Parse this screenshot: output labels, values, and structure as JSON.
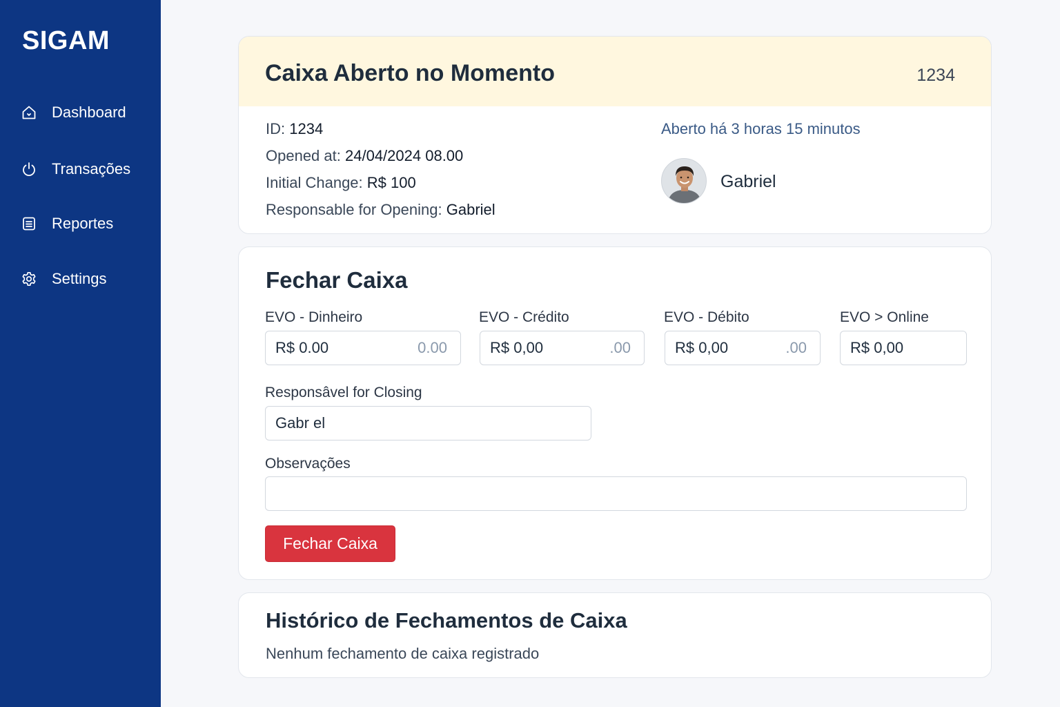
{
  "sidebar": {
    "brand": "SIGAM",
    "items": [
      {
        "label": "Dashboard",
        "icon": "home-icon"
      },
      {
        "label": "Transações",
        "icon": "power-icon"
      },
      {
        "label": "Reportes",
        "icon": "document-icon"
      },
      {
        "label": "Settings",
        "icon": "gear-icon"
      }
    ]
  },
  "open_card": {
    "title": "Caixa Aberto no Momento",
    "header_id": "1234",
    "id_label": "ID:",
    "id_value": "1234",
    "opened_label": "Opened at:",
    "opened_value": "24/04/2024 08.00",
    "change_label": "Initial Change:",
    "change_value": "R$ 100",
    "resp_label": "Responsable for Opening:",
    "resp_value": "Gabriel",
    "elapsed": "Aberto há 3 horas 15 minutos",
    "user_name": "Gabriel"
  },
  "close_card": {
    "title": "Fechar Caixa",
    "fields": [
      {
        "label": "EVO - Dinheiro",
        "value": "R$ 0.00",
        "placeholder": "0.00"
      },
      {
        "label": "EVO - Crédito",
        "value": "R$ 0,00",
        "placeholder": ".00"
      },
      {
        "label": "EVO - Débito",
        "value": "R$ 0,00",
        "placeholder": ".00"
      },
      {
        "label": "EVO > Online",
        "value": "R$ 0,00",
        "placeholder": ""
      }
    ],
    "resp_label": "Responsâvel for Closing",
    "resp_value": "Gabr el",
    "obs_label": "Observações",
    "obs_value": "",
    "button_label": "Fechar Caixa",
    "button_color": "#d9343e"
  },
  "history_card": {
    "title": "Histórico de Fechamentos de Caixa",
    "empty_text": "Nenhum fechamento de caixa registrado"
  },
  "colors": {
    "sidebar_bg": "#0d3683",
    "header_bg": "#fff7df",
    "danger": "#d9343e"
  }
}
